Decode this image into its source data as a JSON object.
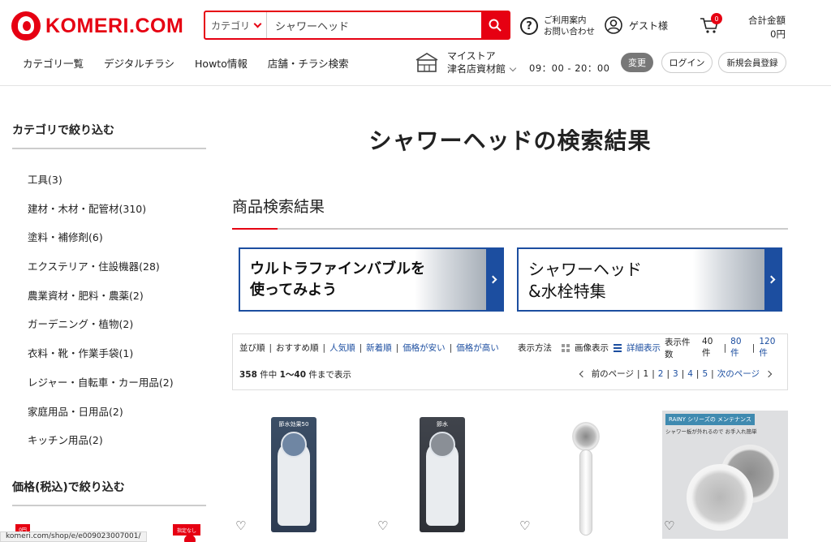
{
  "header": {
    "logo_text": "KOMERI.COM",
    "search": {
      "category_label": "カテゴリ",
      "value": "シャワーヘッド"
    },
    "help": {
      "line1": "ご利用案内",
      "line2": "お問い合わせ"
    },
    "guest_label": "ゲスト様",
    "cart_count": "0",
    "total": {
      "label": "合計金額",
      "value": "0円"
    },
    "nav": [
      "カテゴリ一覧",
      "デジタルチラシ",
      "Howto情報",
      "店舗・チラシ検索"
    ],
    "store": {
      "label": "マイストア",
      "name": "津名店資材館",
      "hours": "09：00 - 20：00"
    },
    "change_button": "変更",
    "login_button": "ログイン",
    "register_button": "新規会員登録"
  },
  "sidebar": {
    "category_title": "カテゴリで絞り込む",
    "categories": [
      "工具(3)",
      "建材・木材・配管材(310)",
      "塗料・補修剤(6)",
      "エクステリア・住設機器(28)",
      "農業資材・肥料・農薬(2)",
      "ガーデニング・植物(2)",
      "衣料・靴・作業手袋(1)",
      "レジャー・自転車・カー用品(2)",
      "家庭用品・日用品(2)",
      "キッチン用品(2)"
    ],
    "price_title": "価格(税込)で絞り込む",
    "price_min_tag": "0円",
    "price_max_tag": "指定なし"
  },
  "main": {
    "page_title": "シャワーヘッドの検索結果",
    "section_title": "商品検索結果",
    "banners": [
      {
        "line1": "ウルトラファインバブルを",
        "line2": "使ってみよう"
      },
      {
        "line1": "シャワーヘッド",
        "line2": "&水栓特集"
      }
    ],
    "sort": {
      "label": "並び順",
      "current": "おすすめ順",
      "options": [
        "人気順",
        "新着順",
        "価格が安い",
        "価格が高い"
      ],
      "display_method_label": "表示方法",
      "image_view": "画像表示",
      "detail_view": "詳細表示",
      "count_label": "表示件数",
      "count_current": "40件",
      "count_options": [
        "80件",
        "120件"
      ]
    },
    "results": {
      "total": "358",
      "total_suffix": "件中",
      "range": "1〜40",
      "range_suffix": "件まで表示"
    },
    "pager": {
      "prev": "前のページ",
      "current": "1",
      "pages": [
        "2",
        "3",
        "4",
        "5"
      ],
      "next": "次のページ"
    },
    "products": [
      {
        "pkg_label": "節水効果50"
      },
      {
        "pkg_label": "節水"
      },
      {
        "pkg_label": ""
      },
      {
        "pkg_label": "RAINY シリーズの メンテナンス",
        "sub": "シャワー板が外れるので お手入れ簡単"
      }
    ]
  },
  "status_url": "komeri.com/shop/e/e009023007001/"
}
